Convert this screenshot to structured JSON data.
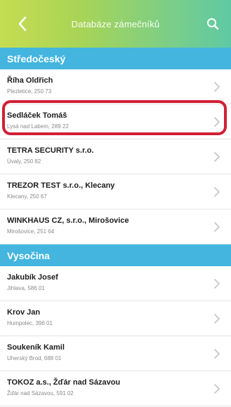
{
  "header": {
    "title": "Databáze zámečníků",
    "back_icon": "chevron-left-icon",
    "search_icon": "search-icon"
  },
  "colors": {
    "header_gradient_start": "#c6dc52",
    "header_gradient_end": "#5fc9a5",
    "section_background": "#43b5df",
    "highlight_border": "#d21f36"
  },
  "sections": [
    {
      "title": "Středočeský",
      "items": [
        {
          "name": "Říha Oldřich",
          "address": "Plezletice, 250 73"
        },
        {
          "name": "Sedláček Tomáš",
          "address": "Lysá nad Labem, 289 22"
        },
        {
          "name": "TETRA SECURITY s.r.o.",
          "address": "Úvaly, 250 82"
        },
        {
          "name": "TREZOR TEST s.r.o., Klecany",
          "address": "Klecany, 250 67"
        },
        {
          "name": "WINKHAUS CZ, s.r.o., Mirošovice",
          "address": "Mirošovice, 251 64"
        }
      ]
    },
    {
      "title": "Vysočina",
      "items": [
        {
          "name": "Jakubík Josef",
          "address": "Jihlava, 586 01"
        },
        {
          "name": "Krov Jan",
          "address": "Humpolec, 396 01"
        },
        {
          "name": "Soukeník Kamil",
          "address": "Uherský Brod, 688 01"
        },
        {
          "name": "TOKOZ a.s., Žďár nad Sázavou",
          "address": "Žďár nad Sázavou, 591 02"
        }
      ]
    }
  ],
  "row_chevron_icon": "chevron-right-icon"
}
